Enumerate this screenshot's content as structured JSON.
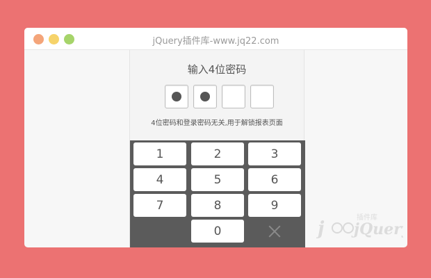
{
  "window": {
    "title": "jQuery插件库-www.jq22.com"
  },
  "pin_entry": {
    "heading": "输入4位密码",
    "digits_entered": 2,
    "digits_total": 4,
    "hint": "4位密码和登录密码无关,用于解锁报表页面"
  },
  "keypad": {
    "keys": [
      "1",
      "2",
      "3",
      "4",
      "5",
      "6",
      "7",
      "8",
      "9",
      "0"
    ],
    "delete_icon": "close-icon"
  },
  "watermark": {
    "text": "jQuery",
    "sub_text": "插件库"
  },
  "colors": {
    "background": "#ec7272",
    "keypad": "#5b5b5b",
    "traffic_red": "#f4a57a",
    "traffic_yellow": "#f6d36a",
    "traffic_green": "#a6d46a"
  }
}
